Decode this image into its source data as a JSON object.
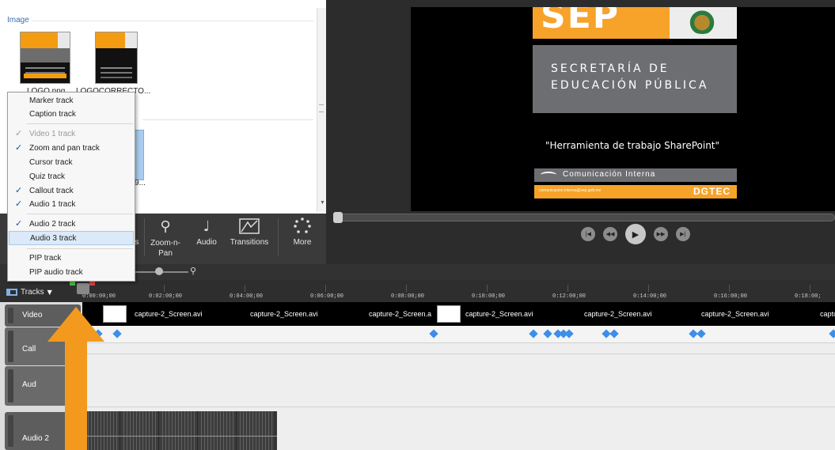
{
  "clip_bin": {
    "section_label": "Image",
    "items": [
      {
        "label": "LOGO.png"
      },
      {
        "label": "LOGOCORRECTO..."
      }
    ],
    "partial_label": "9..."
  },
  "preview": {
    "sep": "SEP",
    "secretaria_line1": "SECRETARÍA DE",
    "secretaria_line2": "EDUCACIÓN PÚBLICA",
    "quote": "\"Herramienta de trabajo SharePoint\"",
    "comunicacion": "Comunicación Interna",
    "email": "comunicacion.interna@sep.gob.mx",
    "dgtec": "DGTEC",
    "transport": {
      "prev_icon": "skip-back-icon",
      "rewind_icon": "rewind-icon",
      "play_icon": "play-icon",
      "forward_icon": "fast-forward-icon",
      "next_icon": "skip-forward-icon"
    }
  },
  "tools": [
    {
      "label": "s",
      "icon": "callouts-icon"
    },
    {
      "label": "Zoom-n-Pan",
      "icon": "magnifier-icon"
    },
    {
      "label": "Audio",
      "icon": "audio-icon"
    },
    {
      "label": "Transitions",
      "icon": "transitions-icon"
    },
    {
      "label": "More",
      "icon": "more-icon"
    }
  ],
  "timeline": {
    "tracks_button": "Tracks",
    "ruler_ticks": [
      "0:00:00;00",
      "0:02:00;00",
      "0:04:00;00",
      "0:06:00;00",
      "0:08:00;00",
      "0:10:00;00",
      "0:12:00;00",
      "0:14:00;00",
      "0:16:00;00",
      "0:18:00;"
    ],
    "track_labels": {
      "video": "Video",
      "callout": "Call",
      "audio1": "Aud",
      "audio2": "Audio 2"
    },
    "video_clips": [
      "capture-2_Screen.avi",
      "capture-2_Screen.avi",
      "capture-2_Screen.a",
      "capture-2_Screen.avi",
      "capture-2_Screen.avi",
      "capture-2_Screen.avi",
      "captu"
    ]
  },
  "tracks_menu": {
    "items": [
      {
        "label": "Marker track",
        "checked": false,
        "disabled": false
      },
      {
        "label": "Caption track",
        "checked": false,
        "disabled": false
      },
      {
        "label": "Video 1 track",
        "checked": true,
        "disabled": true
      },
      {
        "label": "Zoom and pan track",
        "checked": true,
        "disabled": false
      },
      {
        "label": "Cursor track",
        "checked": false,
        "disabled": false
      },
      {
        "label": "Quiz track",
        "checked": false,
        "disabled": false
      },
      {
        "label": "Callout track",
        "checked": true,
        "disabled": false
      },
      {
        "label": "Audio 1 track",
        "checked": true,
        "disabled": false
      },
      {
        "label": "Audio 2 track",
        "checked": true,
        "disabled": false
      },
      {
        "label": "Audio 3 track",
        "checked": false,
        "disabled": false,
        "highlighted": true
      },
      {
        "label": "PIP track",
        "checked": false,
        "disabled": false
      },
      {
        "label": "PIP audio track",
        "checked": false,
        "disabled": false
      }
    ],
    "check_glyph": "✓"
  },
  "colors": {
    "accent_orange": "#f7a229",
    "arrow_orange": "#f39a1e",
    "timeline_bg": "#2e2e2e",
    "diamond_blue": "#3d8ee8"
  }
}
